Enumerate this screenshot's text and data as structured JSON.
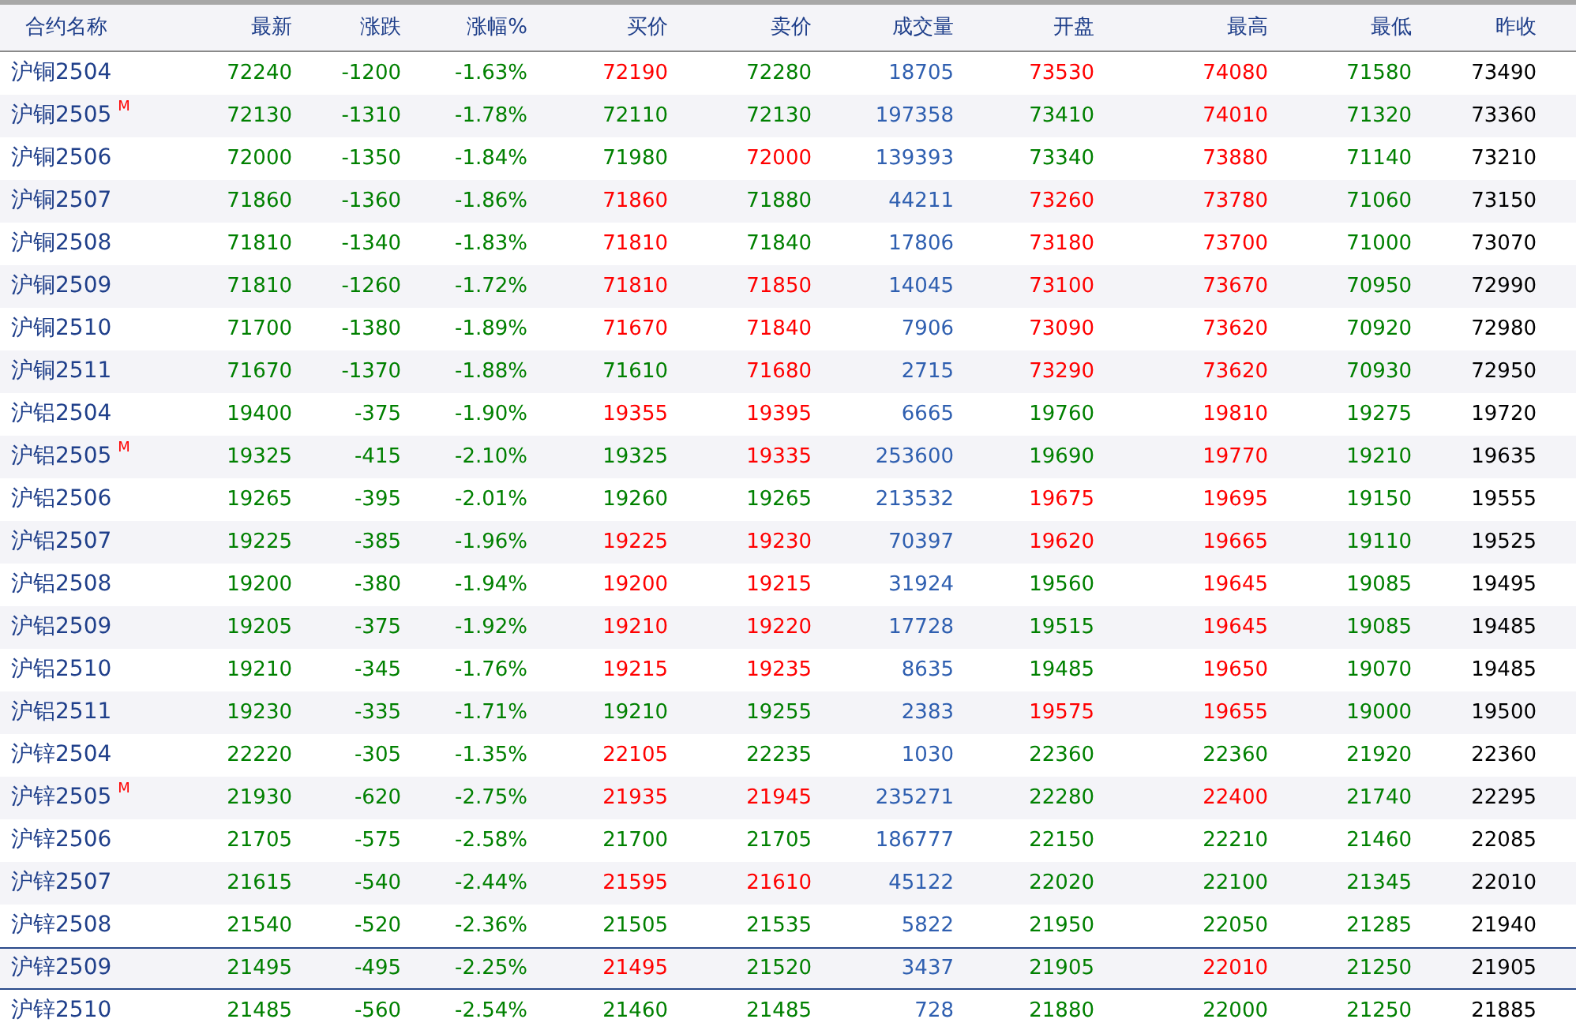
{
  "columns": [
    {
      "label": "合约名称",
      "kind": "name"
    },
    {
      "label": "最新",
      "kind": "price"
    },
    {
      "label": "涨跌",
      "kind": "price"
    },
    {
      "label": "涨幅%",
      "kind": "price"
    },
    {
      "label": "买价",
      "kind": "price"
    },
    {
      "label": "卖价",
      "kind": "price"
    },
    {
      "label": "成交量",
      "kind": "volume"
    },
    {
      "label": "开盘",
      "kind": "price"
    },
    {
      "label": "最高",
      "kind": "price"
    },
    {
      "label": "最低",
      "kind": "price"
    },
    {
      "label": "昨收",
      "kind": "plain"
    }
  ],
  "rows": [
    {
      "name": "沪铜2504",
      "selected": false,
      "cells": [
        {
          "text": "72240",
          "up": false
        },
        {
          "text": "-1200",
          "up": false
        },
        {
          "text": "-1.63%",
          "up": false
        },
        {
          "text": "72190",
          "up": true
        },
        {
          "text": "72280",
          "up": false
        },
        {
          "text": "18705"
        },
        {
          "text": "73530",
          "up": true
        },
        {
          "text": "74080",
          "up": true
        },
        {
          "text": "71580",
          "up": false
        },
        {
          "text": "73490"
        }
      ]
    },
    {
      "name": "沪铜2505",
      "mark": "M",
      "selected": false,
      "cells": [
        {
          "text": "72130",
          "up": false
        },
        {
          "text": "-1310",
          "up": false
        },
        {
          "text": "-1.78%",
          "up": false
        },
        {
          "text": "72110",
          "up": false
        },
        {
          "text": "72130",
          "up": false
        },
        {
          "text": "197358"
        },
        {
          "text": "73410",
          "up": false
        },
        {
          "text": "74010",
          "up": true
        },
        {
          "text": "71320",
          "up": false
        },
        {
          "text": "73360"
        }
      ]
    },
    {
      "name": "沪铜2506",
      "selected": false,
      "cells": [
        {
          "text": "72000",
          "up": false
        },
        {
          "text": "-1350",
          "up": false
        },
        {
          "text": "-1.84%",
          "up": false
        },
        {
          "text": "71980",
          "up": false
        },
        {
          "text": "72000",
          "up": true
        },
        {
          "text": "139393"
        },
        {
          "text": "73340",
          "up": false
        },
        {
          "text": "73880",
          "up": true
        },
        {
          "text": "71140",
          "up": false
        },
        {
          "text": "73210"
        }
      ]
    },
    {
      "name": "沪铜2507",
      "selected": false,
      "cells": [
        {
          "text": "71860",
          "up": false
        },
        {
          "text": "-1360",
          "up": false
        },
        {
          "text": "-1.86%",
          "up": false
        },
        {
          "text": "71860",
          "up": true
        },
        {
          "text": "71880",
          "up": false
        },
        {
          "text": "44211"
        },
        {
          "text": "73260",
          "up": true
        },
        {
          "text": "73780",
          "up": true
        },
        {
          "text": "71060",
          "up": false
        },
        {
          "text": "73150"
        }
      ]
    },
    {
      "name": "沪铜2508",
      "selected": false,
      "cells": [
        {
          "text": "71810",
          "up": false
        },
        {
          "text": "-1340",
          "up": false
        },
        {
          "text": "-1.83%",
          "up": false
        },
        {
          "text": "71810",
          "up": true
        },
        {
          "text": "71840",
          "up": false
        },
        {
          "text": "17806"
        },
        {
          "text": "73180",
          "up": true
        },
        {
          "text": "73700",
          "up": true
        },
        {
          "text": "71000",
          "up": false
        },
        {
          "text": "73070"
        }
      ]
    },
    {
      "name": "沪铜2509",
      "selected": false,
      "cells": [
        {
          "text": "71810",
          "up": false
        },
        {
          "text": "-1260",
          "up": false
        },
        {
          "text": "-1.72%",
          "up": false
        },
        {
          "text": "71810",
          "up": true
        },
        {
          "text": "71850",
          "up": true
        },
        {
          "text": "14045"
        },
        {
          "text": "73100",
          "up": true
        },
        {
          "text": "73670",
          "up": true
        },
        {
          "text": "70950",
          "up": false
        },
        {
          "text": "72990"
        }
      ]
    },
    {
      "name": "沪铜2510",
      "selected": false,
      "cells": [
        {
          "text": "71700",
          "up": false
        },
        {
          "text": "-1380",
          "up": false
        },
        {
          "text": "-1.89%",
          "up": false
        },
        {
          "text": "71670",
          "up": true
        },
        {
          "text": "71840",
          "up": true
        },
        {
          "text": "7906"
        },
        {
          "text": "73090",
          "up": true
        },
        {
          "text": "73620",
          "up": true
        },
        {
          "text": "70920",
          "up": false
        },
        {
          "text": "72980"
        }
      ]
    },
    {
      "name": "沪铜2511",
      "selected": false,
      "cells": [
        {
          "text": "71670",
          "up": false
        },
        {
          "text": "-1370",
          "up": false
        },
        {
          "text": "-1.88%",
          "up": false
        },
        {
          "text": "71610",
          "up": false
        },
        {
          "text": "71680",
          "up": true
        },
        {
          "text": "2715"
        },
        {
          "text": "73290",
          "up": true
        },
        {
          "text": "73620",
          "up": true
        },
        {
          "text": "70930",
          "up": false
        },
        {
          "text": "72950"
        }
      ]
    },
    {
      "name": "沪铝2504",
      "selected": false,
      "cells": [
        {
          "text": "19400",
          "up": false
        },
        {
          "text": "-375",
          "up": false
        },
        {
          "text": "-1.90%",
          "up": false
        },
        {
          "text": "19355",
          "up": true
        },
        {
          "text": "19395",
          "up": true
        },
        {
          "text": "6665"
        },
        {
          "text": "19760",
          "up": false
        },
        {
          "text": "19810",
          "up": true
        },
        {
          "text": "19275",
          "up": false
        },
        {
          "text": "19720"
        }
      ]
    },
    {
      "name": "沪铝2505",
      "mark": "M",
      "selected": false,
      "cells": [
        {
          "text": "19325",
          "up": false
        },
        {
          "text": "-415",
          "up": false
        },
        {
          "text": "-2.10%",
          "up": false
        },
        {
          "text": "19325",
          "up": false
        },
        {
          "text": "19335",
          "up": true
        },
        {
          "text": "253600"
        },
        {
          "text": "19690",
          "up": false
        },
        {
          "text": "19770",
          "up": true
        },
        {
          "text": "19210",
          "up": false
        },
        {
          "text": "19635"
        }
      ]
    },
    {
      "name": "沪铝2506",
      "selected": false,
      "cells": [
        {
          "text": "19265",
          "up": false
        },
        {
          "text": "-395",
          "up": false
        },
        {
          "text": "-2.01%",
          "up": false
        },
        {
          "text": "19260",
          "up": false
        },
        {
          "text": "19265",
          "up": false
        },
        {
          "text": "213532"
        },
        {
          "text": "19675",
          "up": true
        },
        {
          "text": "19695",
          "up": true
        },
        {
          "text": "19150",
          "up": false
        },
        {
          "text": "19555"
        }
      ]
    },
    {
      "name": "沪铝2507",
      "selected": false,
      "cells": [
        {
          "text": "19225",
          "up": false
        },
        {
          "text": "-385",
          "up": false
        },
        {
          "text": "-1.96%",
          "up": false
        },
        {
          "text": "19225",
          "up": true
        },
        {
          "text": "19230",
          "up": true
        },
        {
          "text": "70397"
        },
        {
          "text": "19620",
          "up": true
        },
        {
          "text": "19665",
          "up": true
        },
        {
          "text": "19110",
          "up": false
        },
        {
          "text": "19525"
        }
      ]
    },
    {
      "name": "沪铝2508",
      "selected": false,
      "cells": [
        {
          "text": "19200",
          "up": false
        },
        {
          "text": "-380",
          "up": false
        },
        {
          "text": "-1.94%",
          "up": false
        },
        {
          "text": "19200",
          "up": true
        },
        {
          "text": "19215",
          "up": true
        },
        {
          "text": "31924"
        },
        {
          "text": "19560",
          "up": false
        },
        {
          "text": "19645",
          "up": true
        },
        {
          "text": "19085",
          "up": false
        },
        {
          "text": "19495"
        }
      ]
    },
    {
      "name": "沪铝2509",
      "selected": false,
      "cells": [
        {
          "text": "19205",
          "up": false
        },
        {
          "text": "-375",
          "up": false
        },
        {
          "text": "-1.92%",
          "up": false
        },
        {
          "text": "19210",
          "up": true
        },
        {
          "text": "19220",
          "up": true
        },
        {
          "text": "17728"
        },
        {
          "text": "19515",
          "up": false
        },
        {
          "text": "19645",
          "up": true
        },
        {
          "text": "19085",
          "up": false
        },
        {
          "text": "19485"
        }
      ]
    },
    {
      "name": "沪铝2510",
      "selected": false,
      "cells": [
        {
          "text": "19210",
          "up": false
        },
        {
          "text": "-345",
          "up": false
        },
        {
          "text": "-1.76%",
          "up": false
        },
        {
          "text": "19215",
          "up": true
        },
        {
          "text": "19235",
          "up": true
        },
        {
          "text": "8635"
        },
        {
          "text": "19485",
          "up": false
        },
        {
          "text": "19650",
          "up": true
        },
        {
          "text": "19070",
          "up": false
        },
        {
          "text": "19485"
        }
      ]
    },
    {
      "name": "沪铝2511",
      "selected": false,
      "cells": [
        {
          "text": "19230",
          "up": false
        },
        {
          "text": "-335",
          "up": false
        },
        {
          "text": "-1.71%",
          "up": false
        },
        {
          "text": "19210",
          "up": false
        },
        {
          "text": "19255",
          "up": false
        },
        {
          "text": "2383"
        },
        {
          "text": "19575",
          "up": true
        },
        {
          "text": "19655",
          "up": true
        },
        {
          "text": "19000",
          "up": false
        },
        {
          "text": "19500"
        }
      ]
    },
    {
      "name": "沪锌2504",
      "selected": false,
      "cells": [
        {
          "text": "22220",
          "up": false
        },
        {
          "text": "-305",
          "up": false
        },
        {
          "text": "-1.35%",
          "up": false
        },
        {
          "text": "22105",
          "up": true
        },
        {
          "text": "22235",
          "up": false
        },
        {
          "text": "1030"
        },
        {
          "text": "22360",
          "up": false
        },
        {
          "text": "22360",
          "up": false
        },
        {
          "text": "21920",
          "up": false
        },
        {
          "text": "22360"
        }
      ]
    },
    {
      "name": "沪锌2505",
      "mark": "M",
      "selected": false,
      "cells": [
        {
          "text": "21930",
          "up": false
        },
        {
          "text": "-620",
          "up": false
        },
        {
          "text": "-2.75%",
          "up": false
        },
        {
          "text": "21935",
          "up": true
        },
        {
          "text": "21945",
          "up": true
        },
        {
          "text": "235271"
        },
        {
          "text": "22280",
          "up": false
        },
        {
          "text": "22400",
          "up": true
        },
        {
          "text": "21740",
          "up": false
        },
        {
          "text": "22295"
        }
      ]
    },
    {
      "name": "沪锌2506",
      "selected": false,
      "cells": [
        {
          "text": "21705",
          "up": false
        },
        {
          "text": "-575",
          "up": false
        },
        {
          "text": "-2.58%",
          "up": false
        },
        {
          "text": "21700",
          "up": false
        },
        {
          "text": "21705",
          "up": false
        },
        {
          "text": "186777"
        },
        {
          "text": "22150",
          "up": false
        },
        {
          "text": "22210",
          "up": false
        },
        {
          "text": "21460",
          "up": false
        },
        {
          "text": "22085"
        }
      ]
    },
    {
      "name": "沪锌2507",
      "selected": false,
      "cells": [
        {
          "text": "21615",
          "up": false
        },
        {
          "text": "-540",
          "up": false
        },
        {
          "text": "-2.44%",
          "up": false
        },
        {
          "text": "21595",
          "up": true
        },
        {
          "text": "21610",
          "up": true
        },
        {
          "text": "45122"
        },
        {
          "text": "22020",
          "up": false
        },
        {
          "text": "22100",
          "up": false
        },
        {
          "text": "21345",
          "up": false
        },
        {
          "text": "22010"
        }
      ]
    },
    {
      "name": "沪锌2508",
      "selected": false,
      "cells": [
        {
          "text": "21540",
          "up": false
        },
        {
          "text": "-520",
          "up": false
        },
        {
          "text": "-2.36%",
          "up": false
        },
        {
          "text": "21505",
          "up": false
        },
        {
          "text": "21535",
          "up": false
        },
        {
          "text": "5822"
        },
        {
          "text": "21950",
          "up": false
        },
        {
          "text": "22050",
          "up": false
        },
        {
          "text": "21285",
          "up": false
        },
        {
          "text": "21940"
        }
      ]
    },
    {
      "name": "沪锌2509",
      "selected": true,
      "cells": [
        {
          "text": "21495",
          "up": false
        },
        {
          "text": "-495",
          "up": false
        },
        {
          "text": "-2.25%",
          "up": false
        },
        {
          "text": "21495",
          "up": true
        },
        {
          "text": "21520",
          "up": false
        },
        {
          "text": "3437"
        },
        {
          "text": "21905",
          "up": false
        },
        {
          "text": "22010",
          "up": true
        },
        {
          "text": "21250",
          "up": false
        },
        {
          "text": "21905"
        }
      ]
    },
    {
      "name": "沪锌2510",
      "selected": false,
      "cells": [
        {
          "text": "21485",
          "up": false
        },
        {
          "text": "-560",
          "up": false
        },
        {
          "text": "-2.54%",
          "up": false
        },
        {
          "text": "21460",
          "up": false
        },
        {
          "text": "21485",
          "up": false
        },
        {
          "text": "728"
        },
        {
          "text": "21880",
          "up": false
        },
        {
          "text": "22000",
          "up": false
        },
        {
          "text": "21250",
          "up": false
        },
        {
          "text": "21885"
        }
      ]
    }
  ]
}
